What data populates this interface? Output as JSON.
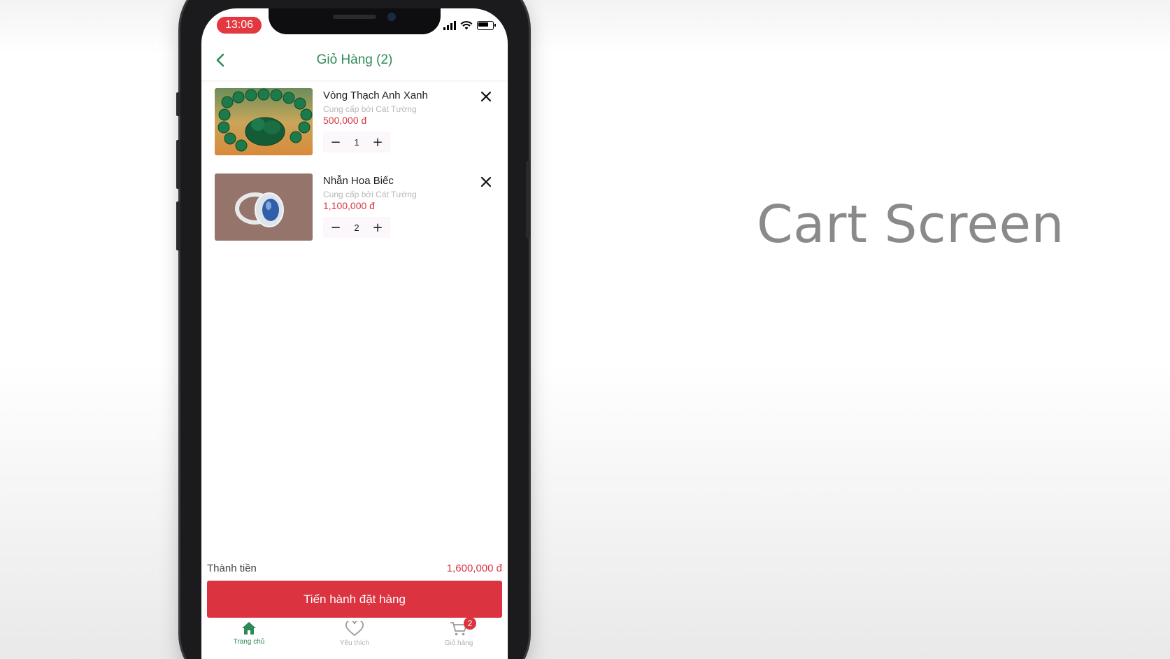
{
  "caption": "Cart Screen",
  "status_bar": {
    "time": "13:06"
  },
  "header": {
    "title": "Giỏ Hàng (2)"
  },
  "cart_items": [
    {
      "name": "Vòng Thạch Anh Xanh",
      "vendor": "Cung cấp bởi Cát Tường",
      "price": "500,000 đ",
      "quantity": "1"
    },
    {
      "name": "Nhẫn Hoa Biếc",
      "vendor": "Cung cấp bởi Cát Tường",
      "price": "1,100,000 đ",
      "quantity": "2"
    }
  ],
  "summary": {
    "total_label": "Thành tiền",
    "total_value": "1,600,000 đ",
    "checkout_label": "Tiến hành đặt hàng"
  },
  "tabbar": {
    "tabs": [
      {
        "label": "Trang chủ",
        "icon": "home-icon",
        "active": true
      },
      {
        "label": "Yêu thích",
        "icon": "heart-icon",
        "active": false
      },
      {
        "label": "Giỏ hàng",
        "icon": "cart-icon",
        "active": false
      }
    ],
    "cart_badge": "2"
  },
  "colors": {
    "accent_green": "#2e8b57",
    "accent_red": "#dc3340",
    "price_red": "#d93644"
  }
}
